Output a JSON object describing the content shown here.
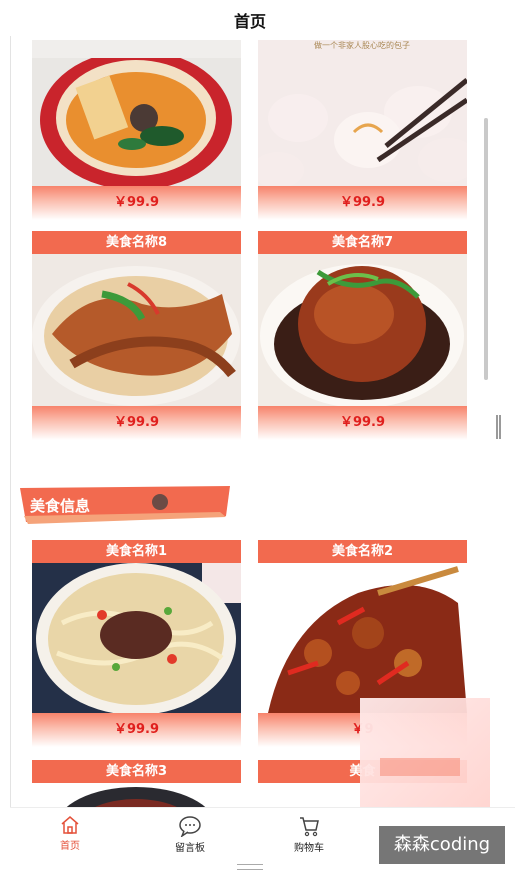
{
  "header": {
    "title": "首页"
  },
  "cards_top": [
    {
      "price": "￥99.9"
    },
    {
      "price": "￥99.9"
    }
  ],
  "cards_mid": [
    {
      "name": "美食名称8",
      "price": "￥99.9"
    },
    {
      "name": "美食名称7",
      "price": "￥99.9"
    }
  ],
  "section": {
    "title": "美食信息"
  },
  "cards_info": [
    {
      "name": "美食名称1",
      "price": "￥99.9"
    },
    {
      "name": "美食名称2",
      "price": "￥9"
    }
  ],
  "cards_bottom": [
    {
      "name": "美食名称3"
    },
    {
      "name": "美食"
    }
  ],
  "photo_caption": "做一个非家人股心吃的包子",
  "tabbar": {
    "items": [
      {
        "label": "首页",
        "icon": "home-icon"
      },
      {
        "label": "留言板",
        "icon": "chat-bubble-icon"
      },
      {
        "label": "购物车",
        "icon": "cart-icon"
      }
    ]
  },
  "watermark": "森森coding",
  "colors": {
    "accent": "#f26a4f",
    "price": "#e0201e",
    "tab_active": "#e4513a"
  }
}
